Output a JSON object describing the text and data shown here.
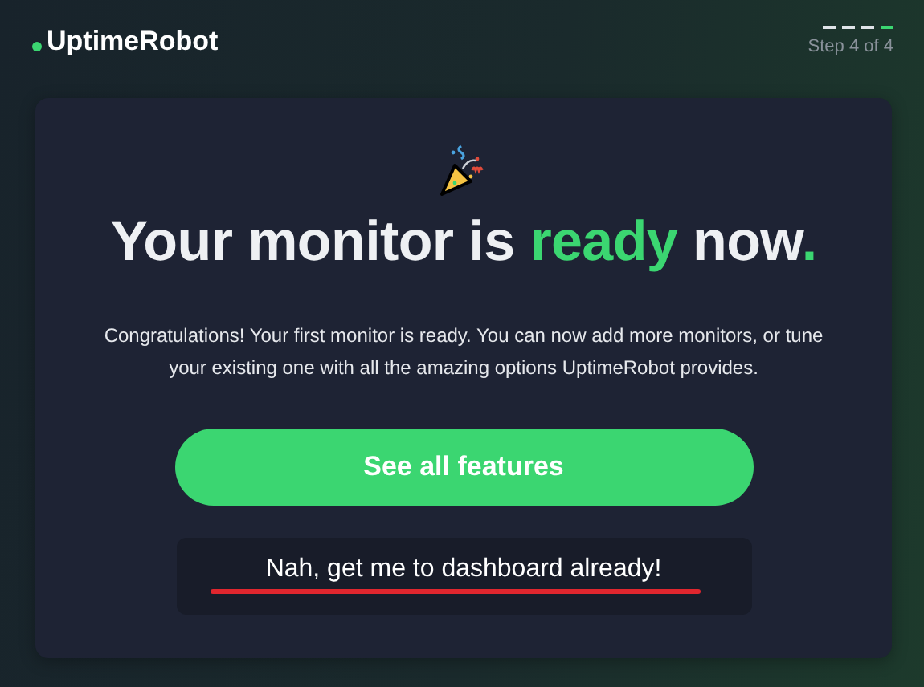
{
  "brand": {
    "name": "UptimeRobot"
  },
  "progress": {
    "steps": [
      {
        "selected": false
      },
      {
        "selected": false
      },
      {
        "selected": false
      },
      {
        "selected": true
      }
    ],
    "label": "Step 4 of 4"
  },
  "card": {
    "heading": [
      {
        "text": "Your monitor is ",
        "accent": false
      },
      {
        "text": "ready",
        "accent": true
      },
      {
        "text": " now",
        "accent": false
      },
      {
        "text": ".",
        "accent": true
      }
    ],
    "message": "Congratulations! Your first monitor is ready. You can now add more monitors, or tune your existing one with all the amazing options UptimeRobot provides.",
    "primary_button": {
      "label": "See all features"
    },
    "secondary_button": {
      "label": "Nah, get me to dashboard already!",
      "underlined": true
    }
  }
}
